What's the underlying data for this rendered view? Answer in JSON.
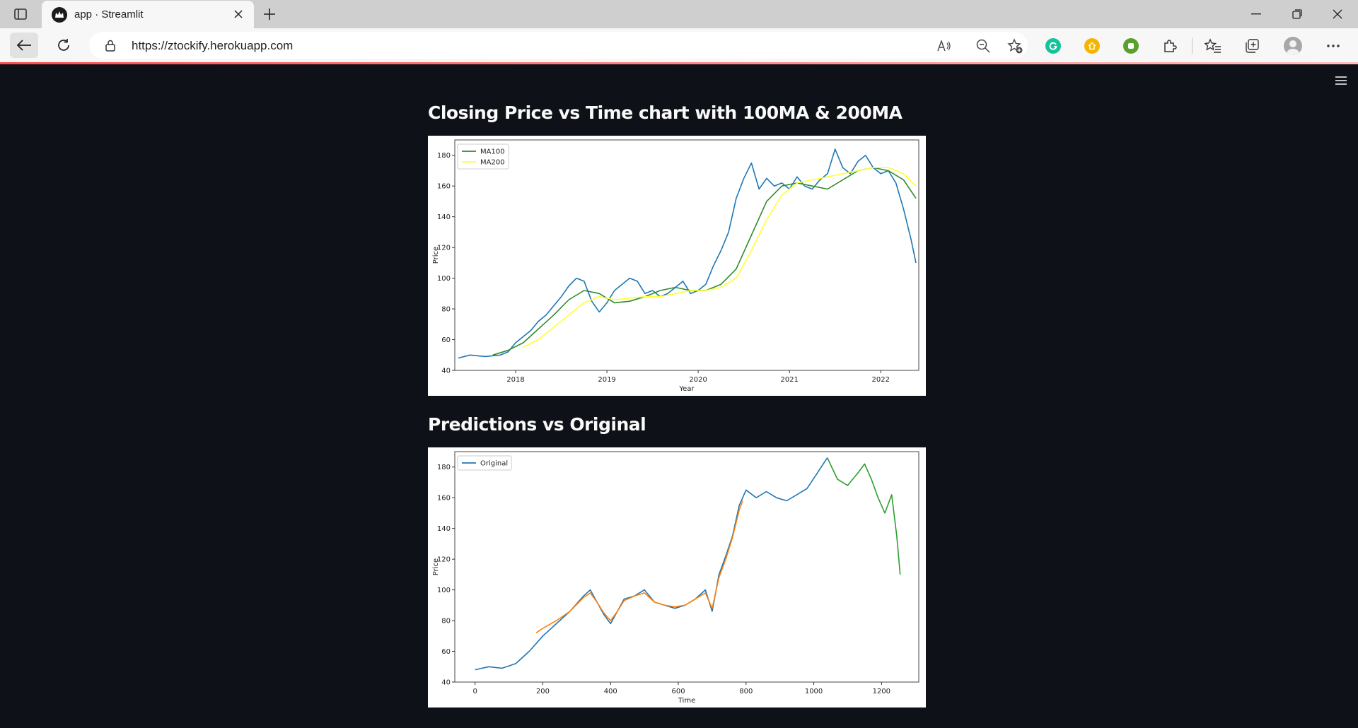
{
  "browser": {
    "tab_title": "app · Streamlit",
    "url": "https://ztockify.herokuapp.com",
    "icons": {
      "tab_actions": "tab-actions-icon",
      "favicon": "streamlit-crown-icon",
      "close": "close-icon",
      "new_tab": "plus-icon",
      "back": "arrow-left-icon",
      "refresh": "refresh-icon",
      "lock": "lock-icon",
      "read_aloud": "read-aloud-icon",
      "zoom": "zoom-out-icon",
      "favorite": "star-add-icon",
      "grammarly": "grammarly-icon",
      "ext_home": "home-extension-icon",
      "ext_green": "green-extension-icon",
      "extensions": "puzzle-icon",
      "favorites": "favorites-icon",
      "collections": "collections-icon",
      "profile": "profile-avatar",
      "more": "ellipsis-icon"
    },
    "colors": {
      "accent_line": "#ff4b4b",
      "grammarly": "#15c39a",
      "ext_home": "#f5b400",
      "ext_green": "#5aa02c"
    }
  },
  "app": {
    "background": "#0e1117",
    "heading1": "Closing Price vs Time chart with 100MA & 200MA",
    "heading2": "Predictions vs Original"
  },
  "chart_data": [
    {
      "type": "line",
      "title": "",
      "xlabel": "Year",
      "ylabel": "Price",
      "ylim": [
        40,
        190
      ],
      "xlim": [
        "2017-05-01",
        "2022-06-01"
      ],
      "xticks": [
        2018,
        2019,
        2020,
        2021,
        2022
      ],
      "yticks": [
        40,
        60,
        80,
        100,
        120,
        140,
        160,
        180
      ],
      "legend": "top-left",
      "series": [
        {
          "role": "close",
          "color": "#1f77b4",
          "x": [
            "2017-05-15",
            "2017-07-01",
            "2017-09-01",
            "2017-11-01",
            "2017-12-01",
            "2018-01-01",
            "2018-02-01",
            "2018-03-01",
            "2018-04-01",
            "2018-05-01",
            "2018-06-01",
            "2018-07-01",
            "2018-08-01",
            "2018-09-01",
            "2018-10-01",
            "2018-11-01",
            "2018-12-01",
            "2019-01-01",
            "2019-02-01",
            "2019-03-01",
            "2019-04-01",
            "2019-05-01",
            "2019-06-01",
            "2019-07-01",
            "2019-08-01",
            "2019-09-01",
            "2019-10-01",
            "2019-11-01",
            "2019-12-01",
            "2020-01-01",
            "2020-02-01",
            "2020-03-01",
            "2020-04-01",
            "2020-05-01",
            "2020-06-01",
            "2020-07-01",
            "2020-08-01",
            "2020-09-01",
            "2020-10-01",
            "2020-11-01",
            "2020-12-01",
            "2021-01-01",
            "2021-02-01",
            "2021-03-01",
            "2021-04-01",
            "2021-05-01",
            "2021-06-01",
            "2021-07-01",
            "2021-08-01",
            "2021-09-01",
            "2021-10-01",
            "2021-11-01",
            "2021-12-01",
            "2022-01-01",
            "2022-02-01",
            "2022-03-01",
            "2022-04-01",
            "2022-05-01",
            "2022-05-20"
          ],
          "y": [
            48,
            50,
            49,
            50,
            52,
            58,
            62,
            66,
            72,
            76,
            82,
            88,
            95,
            100,
            98,
            85,
            78,
            84,
            92,
            96,
            100,
            98,
            90,
            92,
            88,
            90,
            94,
            98,
            90,
            92,
            96,
            108,
            118,
            130,
            152,
            165,
            175,
            158,
            165,
            160,
            162,
            158,
            166,
            160,
            158,
            164,
            168,
            184,
            172,
            168,
            176,
            180,
            172,
            168,
            170,
            162,
            145,
            125,
            110
          ]
        },
        {
          "name": "MA100",
          "color": "#2e8b2e",
          "x": [
            "2017-10-01",
            "2017-12-01",
            "2018-02-01",
            "2018-04-01",
            "2018-06-01",
            "2018-08-01",
            "2018-10-01",
            "2018-12-01",
            "2019-02-01",
            "2019-04-01",
            "2019-06-01",
            "2019-08-01",
            "2019-10-01",
            "2019-12-01",
            "2020-02-01",
            "2020-04-01",
            "2020-06-01",
            "2020-08-01",
            "2020-10-01",
            "2020-12-01",
            "2021-02-01",
            "2021-04-01",
            "2021-06-01",
            "2021-08-01",
            "2021-10-01",
            "2021-12-01",
            "2022-02-01",
            "2022-04-01",
            "2022-05-20"
          ],
          "y": [
            50,
            53,
            58,
            67,
            76,
            86,
            92,
            90,
            84,
            85,
            88,
            92,
            94,
            92,
            92,
            96,
            106,
            128,
            150,
            160,
            162,
            160,
            158,
            164,
            170,
            172,
            170,
            164,
            152
          ]
        },
        {
          "name": "MA200",
          "color": "#ffff33",
          "x": [
            "2018-02-01",
            "2018-04-01",
            "2018-06-01",
            "2018-08-01",
            "2018-10-01",
            "2018-12-01",
            "2019-02-01",
            "2019-04-01",
            "2019-06-01",
            "2019-08-01",
            "2019-10-01",
            "2019-12-01",
            "2020-02-01",
            "2020-04-01",
            "2020-06-01",
            "2020-08-01",
            "2020-10-01",
            "2020-12-01",
            "2021-02-01",
            "2021-04-01",
            "2021-06-01",
            "2021-08-01",
            "2021-10-01",
            "2021-12-01",
            "2022-02-01",
            "2022-04-01",
            "2022-05-20"
          ],
          "y": [
            55,
            60,
            68,
            76,
            84,
            88,
            86,
            87,
            88,
            88,
            90,
            92,
            92,
            94,
            100,
            118,
            138,
            154,
            162,
            164,
            166,
            168,
            170,
            172,
            172,
            168,
            160
          ]
        }
      ]
    },
    {
      "type": "line",
      "title": "",
      "xlabel": "Time",
      "ylabel": "Price",
      "ylim": [
        40,
        190
      ],
      "xlim": [
        -60,
        1310
      ],
      "xticks": [
        0,
        200,
        400,
        600,
        800,
        1000,
        1200
      ],
      "yticks": [
        40,
        60,
        80,
        100,
        120,
        140,
        160,
        180
      ],
      "legend": "top-left",
      "series": [
        {
          "name": "Original",
          "color": "#1f77b4",
          "x": [
            0,
            40,
            80,
            120,
            160,
            200,
            240,
            280,
            320,
            340,
            360,
            380,
            400,
            420,
            440,
            470,
            500,
            530,
            560,
            590,
            620,
            650,
            680,
            700,
            720,
            740,
            760,
            780,
            800,
            830,
            860,
            890,
            920,
            950,
            980,
            1010,
            1040
          ],
          "y": [
            48,
            50,
            49,
            52,
            60,
            70,
            78,
            86,
            96,
            100,
            92,
            84,
            78,
            86,
            94,
            96,
            100,
            92,
            90,
            88,
            90,
            94,
            100,
            86,
            110,
            122,
            135,
            155,
            165,
            160,
            164,
            160,
            158,
            162,
            166,
            176,
            186
          ]
        },
        {
          "role": "train-prediction",
          "color": "#ff7f0e",
          "x": [
            180,
            200,
            240,
            280,
            320,
            340,
            360,
            380,
            400,
            420,
            440,
            470,
            500,
            530,
            560,
            590,
            620,
            650,
            680,
            700,
            720,
            740,
            760,
            780,
            790
          ],
          "y": [
            72,
            75,
            80,
            86,
            95,
            98,
            92,
            85,
            80,
            86,
            93,
            96,
            98,
            92,
            90,
            89,
            90,
            94,
            98,
            88,
            108,
            120,
            134,
            152,
            158
          ]
        },
        {
          "role": "test-prediction",
          "color": "#2ca02c",
          "x": [
            1040,
            1070,
            1100,
            1130,
            1150,
            1170,
            1190,
            1210,
            1230,
            1245,
            1255
          ],
          "y": [
            186,
            172,
            168,
            176,
            182,
            172,
            160,
            150,
            162,
            135,
            110
          ]
        }
      ]
    }
  ]
}
